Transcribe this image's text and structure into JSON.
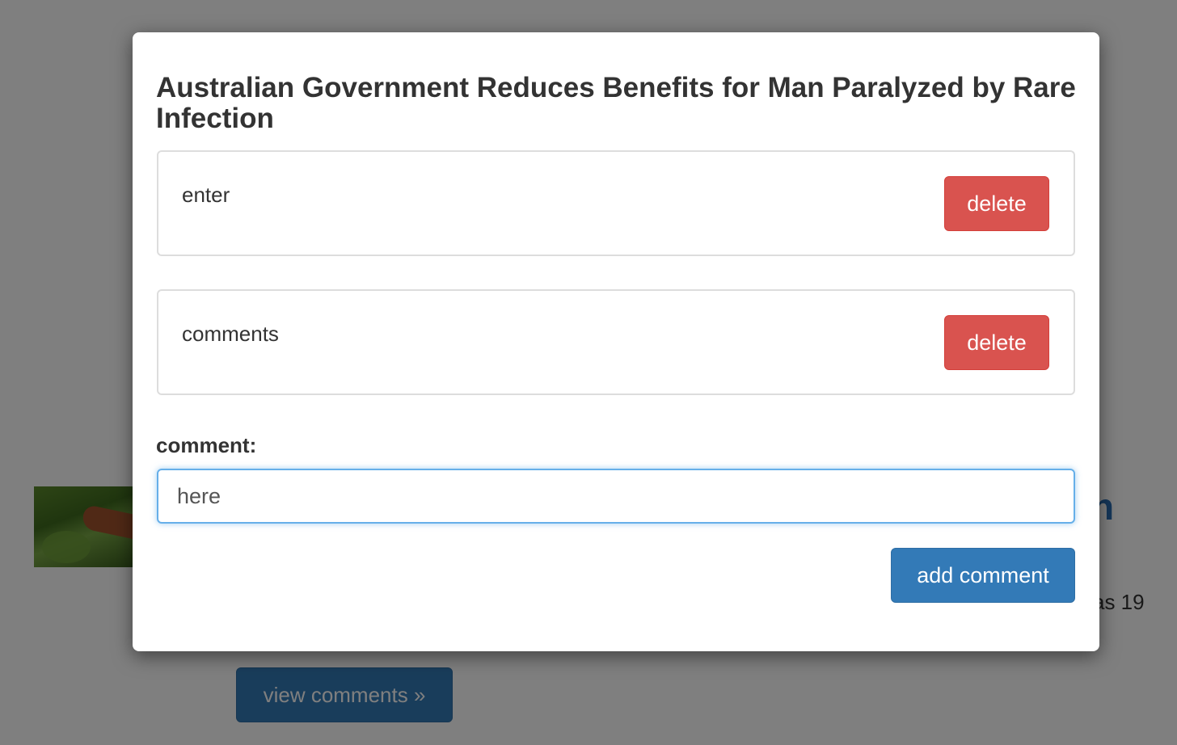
{
  "background": {
    "heading_fragment": "n",
    "text_fragment": "as 19",
    "view_comments_label": "view comments »"
  },
  "modal": {
    "title": "Australian Government Reduces Benefits for Man Paralyzed by Rare Infection",
    "comments": [
      {
        "text": "enter",
        "delete_label": "delete"
      },
      {
        "text": "comments",
        "delete_label": "delete"
      }
    ],
    "comment_label": "comment:",
    "comment_input_value": "here",
    "add_comment_label": "add comment"
  },
  "colors": {
    "primary": "#337ab7",
    "danger": "#d9534f",
    "focus_border": "#66afe9"
  }
}
